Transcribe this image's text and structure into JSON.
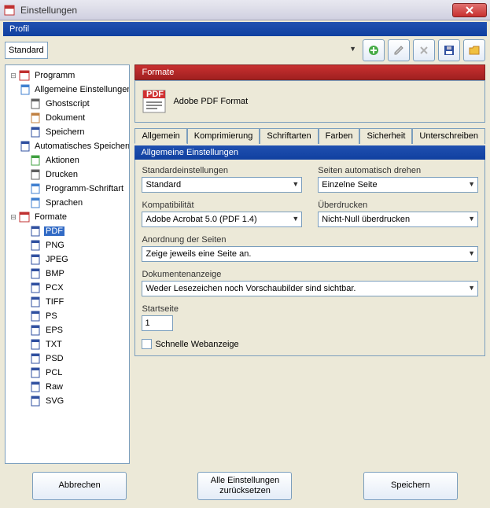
{
  "window": {
    "title": "Einstellungen"
  },
  "profile": {
    "label": "Profil",
    "selected": "Standard"
  },
  "tree": {
    "root1": "Programm",
    "programm_children": [
      "Allgemeine Einstellungen",
      "Ghostscript",
      "Dokument",
      "Speichern",
      "Automatisches Speichern",
      "Aktionen",
      "Drucken",
      "Programm-Schriftart",
      "Sprachen"
    ],
    "root2": "Formate",
    "formate_children": [
      "PDF",
      "PNG",
      "JPEG",
      "BMP",
      "PCX",
      "TIFF",
      "PS",
      "EPS",
      "TXT",
      "PSD",
      "PCL",
      "Raw",
      "SVG"
    ],
    "selected": "PDF"
  },
  "content": {
    "format_header": "Formate",
    "format_name": "Adobe PDF Format",
    "tabs": [
      "Allgemein",
      "Komprimierung",
      "Schriftarten",
      "Farben",
      "Sicherheit",
      "Unterschreiben"
    ],
    "active_tab": 0,
    "section_title": "Allgemeine Einstellungen",
    "fields": {
      "default_label": "Standardeinstellungen",
      "default_value": "Standard",
      "rotate_label": "Seiten automatisch drehen",
      "rotate_value": "Einzelne Seite",
      "compat_label": "Kompatibilität",
      "compat_value": "Adobe Acrobat 5.0 (PDF 1.4)",
      "overprint_label": "Überdrucken",
      "overprint_value": "Nicht-Null überdrucken",
      "order_label": "Anordnung der Seiten",
      "order_value": "Zeige jeweils eine Seite an.",
      "docview_label": "Dokumentenanzeige",
      "docview_value": "Weder Lesezeichen noch Vorschaubilder sind sichtbar.",
      "startpage_label": "Startseite",
      "startpage_value": "1",
      "fastweb_label": "Schnelle Webanzeige"
    }
  },
  "buttons": {
    "cancel": "Abbrechen",
    "reset": "Alle Einstellungen zurücksetzen",
    "save": "Speichern"
  }
}
